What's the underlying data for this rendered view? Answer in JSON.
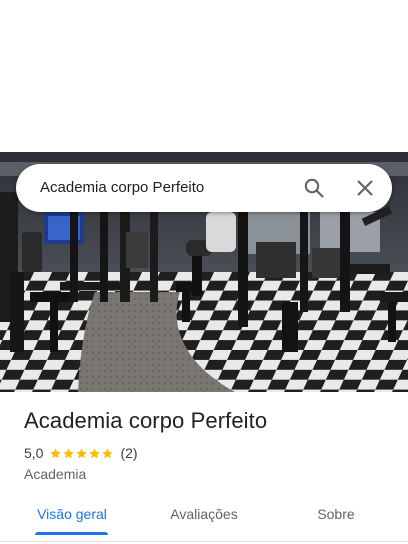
{
  "search": {
    "query": "Academia corpo Perfeito",
    "search_icon": "search-icon",
    "close_icon": "close-icon"
  },
  "hero_photo": {
    "subject": "gym-interior-photo"
  },
  "place": {
    "title": "Academia corpo Perfeito",
    "rating": "5,0",
    "stars": 5,
    "review_count": "(2)",
    "category": "Academia"
  },
  "tabs": [
    {
      "label": "Visão geral",
      "active": true
    },
    {
      "label": "Avaliações",
      "active": false
    },
    {
      "label": "Sobre",
      "active": false
    }
  ],
  "colors": {
    "accent": "#1a73e8",
    "star": "#fbbc04",
    "text_primary": "#202124",
    "text_secondary": "#5f6368"
  }
}
